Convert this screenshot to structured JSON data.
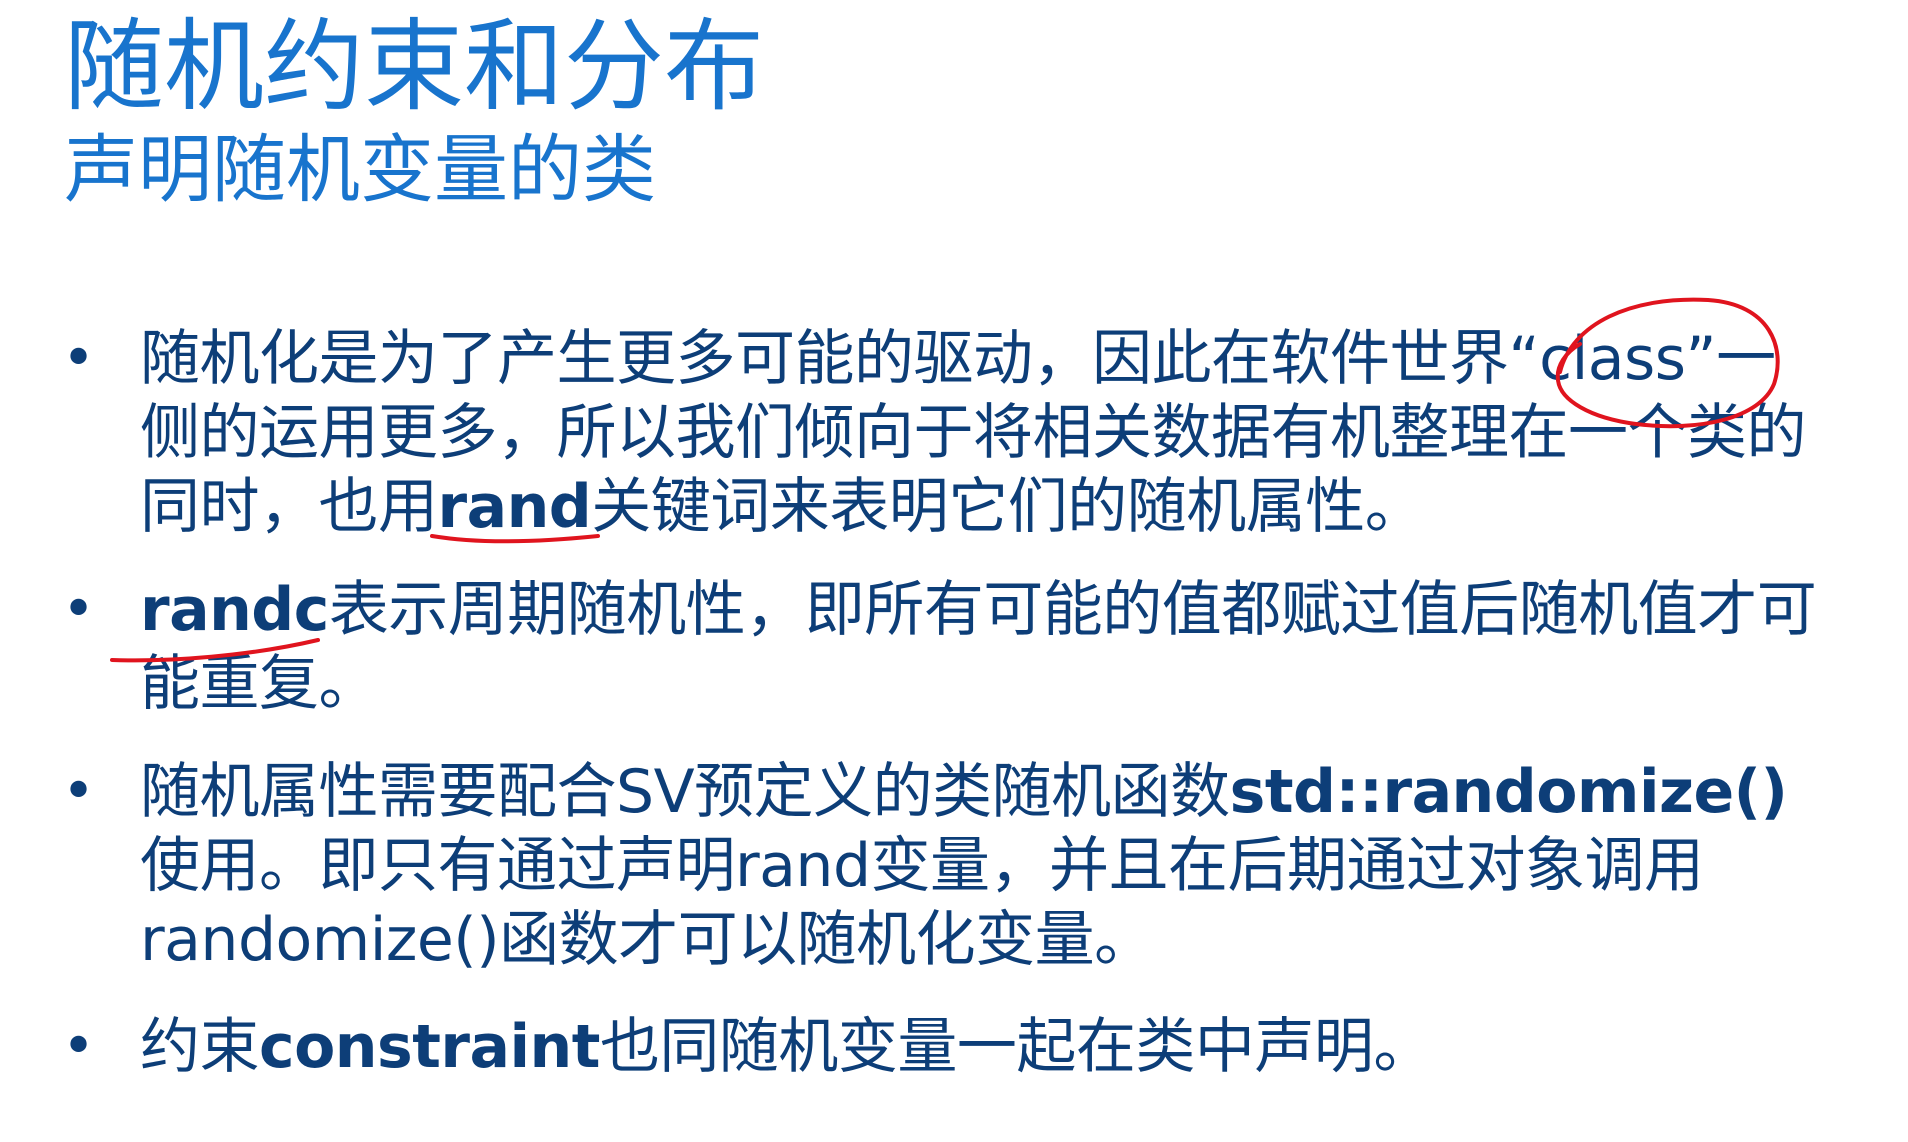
{
  "title": "随机约束和分布",
  "subtitle": "声明随机变量的类",
  "bullet_marker": "•",
  "bullets": [
    {
      "lines": [
        {
          "text": "随机化是为了产生更多可能的驱动，因此在软件世界“class”一"
        },
        {
          "text": "侧的运用更多，所以我们倾向于将相关数据有机整理在一个类的"
        },
        {
          "pre": "同时，也用",
          "bold": "rand",
          "post": "关键词来表明它们的随机属性。"
        }
      ]
    },
    {
      "lines": [
        {
          "bold": "randc",
          "post": "表示周期随机性，即所有可能的值都赋过值后随机值才可"
        },
        {
          "text": "能重复。"
        }
      ]
    },
    {
      "lines": [
        {
          "pre": "随机属性需要配合SV预定义的类随机函数",
          "bold": "std::randomize()"
        },
        {
          "text": "使用。即只有通过声明rand变量，并且在后期通过对象调用"
        },
        {
          "text": "randomize()函数才可以随机化变量。"
        }
      ]
    },
    {
      "lines": [
        {
          "pre": "约束",
          "bold": "constraint",
          "post": "也同随机变量一起在类中声明。"
        }
      ]
    }
  ],
  "colors": {
    "title": "#1874cd",
    "body": "#0d3e78",
    "annotation": "#e0141e"
  }
}
